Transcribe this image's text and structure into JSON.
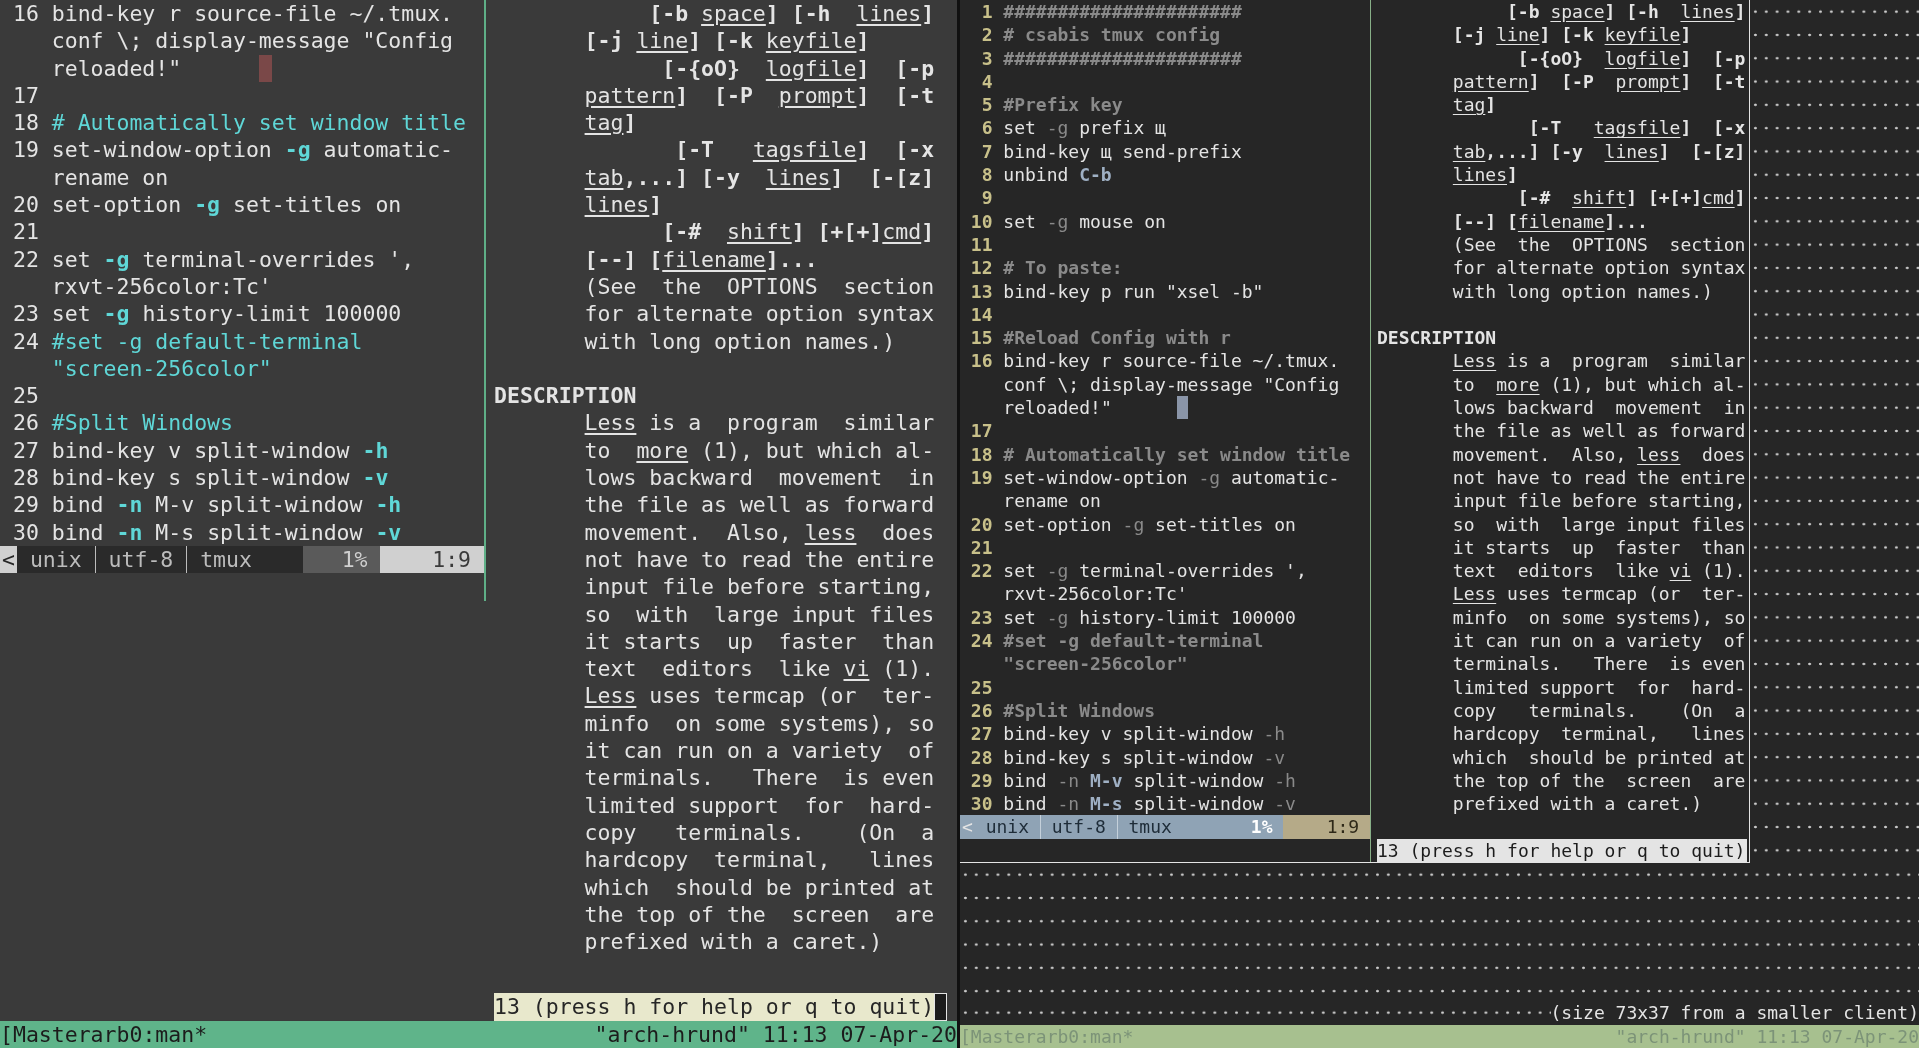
{
  "terminals": [
    {
      "kind": "gray",
      "editor": {
        "rows": [
          {
            "number": "16",
            "parts": [
              {
                "text": "bind-key r source-file ~/.tmux.",
                "kind": "plain"
              }
            ]
          },
          {
            "parts": [
              {
                "text": "conf \\; display-message \"Config",
                "kind": "plain"
              }
            ]
          },
          {
            "parts": [
              {
                "text": "reloaded!\"      ",
                "kind": "plain"
              },
              {
                "kind": "cursor"
              }
            ]
          },
          {
            "number": "17"
          },
          {
            "number": "18",
            "parts": [
              {
                "text": "# Automatically set window title",
                "kind": "comment"
              }
            ]
          },
          {
            "number": "19",
            "parts": [
              {
                "text": "set-window-option ",
                "kind": "plain"
              },
              {
                "text": "-g",
                "kind": "flag"
              },
              {
                "text": " automatic-",
                "kind": "plain"
              }
            ]
          },
          {
            "parts": [
              {
                "text": "rename on",
                "kind": "plain"
              }
            ]
          },
          {
            "number": "20",
            "parts": [
              {
                "text": "set-option ",
                "kind": "plain"
              },
              {
                "text": "-g",
                "kind": "flag"
              },
              {
                "text": " set-titles on",
                "kind": "plain"
              }
            ]
          },
          {
            "number": "21"
          },
          {
            "number": "22",
            "parts": [
              {
                "text": "set ",
                "kind": "plain"
              },
              {
                "text": "-g",
                "kind": "flag"
              },
              {
                "text": " terminal-overrides ',",
                "kind": "plain"
              }
            ]
          },
          {
            "parts": [
              {
                "text": "rxvt-256color:Tc'",
                "kind": "plain"
              }
            ]
          },
          {
            "number": "23",
            "parts": [
              {
                "text": "set ",
                "kind": "plain"
              },
              {
                "text": "-g",
                "kind": "flag"
              },
              {
                "text": " history-limit 100000",
                "kind": "plain"
              }
            ]
          },
          {
            "number": "24",
            "parts": [
              {
                "text": "#set -g default-terminal",
                "kind": "comment"
              }
            ]
          },
          {
            "parts": [
              {
                "text": "\"screen-256color\"",
                "kind": "comment"
              }
            ]
          },
          {
            "number": "25"
          },
          {
            "number": "26",
            "parts": [
              {
                "text": "#Split Windows",
                "kind": "comment"
              }
            ]
          },
          {
            "number": "27",
            "parts": [
              {
                "text": "bind-key v split-window ",
                "kind": "plain"
              },
              {
                "text": "-h",
                "kind": "flag"
              }
            ]
          },
          {
            "number": "28",
            "parts": [
              {
                "text": "bind-key s split-window ",
                "kind": "plain"
              },
              {
                "text": "-v",
                "kind": "flag"
              }
            ]
          },
          {
            "number": "29",
            "parts": [
              {
                "text": "bind ",
                "kind": "plain"
              },
              {
                "text": "-n ",
                "kind": "flag"
              },
              {
                "text": "M-v",
                "kind": "key"
              },
              {
                "text": " split-window ",
                "kind": "plain"
              },
              {
                "text": "-h",
                "kind": "flag"
              }
            ]
          },
          {
            "number": "30",
            "parts": [
              {
                "text": "bind ",
                "kind": "plain"
              },
              {
                "text": "-n ",
                "kind": "flag"
              },
              {
                "text": "M-s",
                "kind": "key"
              },
              {
                "text": " split-window ",
                "kind": "plain"
              },
              {
                "text": "-v",
                "kind": "flag"
              }
            ]
          }
        ],
        "status": {
          "arrow": "<",
          "items": [
            "unix",
            "utf-8",
            "tmux"
          ],
          "percent": "1%",
          "position": "1:9"
        }
      },
      "pager": {
        "rows": [
          {
            "kind": "text",
            "parts": [
              {
                "text": "     [-b ",
                "kind": "bold"
              },
              {
                "text": "space",
                "kind": "under"
              },
              {
                "text": "] [-h  ",
                "kind": "bold"
              },
              {
                "text": "lines",
                "kind": "under"
              },
              {
                "text": "]",
                "kind": "bold"
              }
            ]
          },
          {
            "kind": "text",
            "parts": [
              {
                "text": "[-j ",
                "kind": "bold"
              },
              {
                "text": "line",
                "kind": "under"
              },
              {
                "text": "] [-k ",
                "kind": "bold"
              },
              {
                "text": "keyfile",
                "kind": "under"
              },
              {
                "text": "]",
                "kind": "bold"
              }
            ]
          },
          {
            "kind": "text",
            "parts": [
              {
                "text": "      [-{oO}  ",
                "kind": "bold"
              },
              {
                "text": "logfile",
                "kind": "under"
              },
              {
                "text": "]  [-p",
                "kind": "bold"
              }
            ]
          },
          {
            "kind": "text",
            "parts": [
              {
                "text": "pattern",
                "kind": "under"
              },
              {
                "text": "]  [-P  ",
                "kind": "bold"
              },
              {
                "text": "prompt",
                "kind": "under"
              },
              {
                "text": "]  [-t",
                "kind": "bold"
              }
            ]
          },
          {
            "kind": "text",
            "parts": [
              {
                "text": "tag",
                "kind": "under"
              },
              {
                "text": "]",
                "kind": "bold"
              }
            ]
          },
          {
            "kind": "text",
            "parts": [
              {
                "text": "       [-T   ",
                "kind": "bold"
              },
              {
                "text": "tagsfile",
                "kind": "under"
              },
              {
                "text": "]  [-x",
                "kind": "bold"
              }
            ]
          },
          {
            "kind": "text",
            "parts": [
              {
                "text": "tab",
                "kind": "under"
              },
              {
                "text": ",...] [-y  ",
                "kind": "bold"
              },
              {
                "text": "lines",
                "kind": "under"
              },
              {
                "text": "]  [-[z]",
                "kind": "bold"
              }
            ]
          },
          {
            "kind": "text",
            "parts": [
              {
                "text": "lines",
                "kind": "under"
              },
              {
                "text": "]",
                "kind": "bold"
              }
            ]
          },
          {
            "kind": "text",
            "parts": [
              {
                "text": "      [-#  ",
                "kind": "bold"
              },
              {
                "text": "shift",
                "kind": "under"
              },
              {
                "text": "] [+[+]",
                "kind": "bold"
              },
              {
                "text": "cmd",
                "kind": "under"
              },
              {
                "text": "]",
                "kind": "bold"
              }
            ]
          },
          {
            "kind": "text",
            "parts": [
              {
                "text": "[--] [",
                "kind": "bold"
              },
              {
                "text": "filename",
                "kind": "under"
              },
              {
                "text": "]...",
                "kind": "bold"
              }
            ]
          },
          {
            "kind": "text",
            "parts": [
              {
                "text": "(See  the  OPTIONS  section",
                "kind": "plain"
              }
            ]
          },
          {
            "kind": "text",
            "parts": [
              {
                "text": "for alternate option syntax",
                "kind": "plain"
              }
            ]
          },
          {
            "kind": "text",
            "parts": [
              {
                "text": "with long option names.)",
                "kind": "plain"
              }
            ]
          },
          {
            "kind": "blank"
          },
          {
            "kind": "heading",
            "text": "DESCRIPTION"
          },
          {
            "kind": "text",
            "parts": [
              {
                "text": "Less",
                "kind": "under"
              },
              {
                "text": " is a  program  similar",
                "kind": "plain"
              }
            ]
          },
          {
            "kind": "text",
            "parts": [
              {
                "text": "to  ",
                "kind": "plain"
              },
              {
                "text": "more",
                "kind": "under"
              },
              {
                "text": " (1), but which al-",
                "kind": "plain"
              }
            ]
          },
          {
            "kind": "text",
            "parts": [
              {
                "text": "lows backward  movement  in",
                "kind": "plain"
              }
            ]
          },
          {
            "kind": "text",
            "parts": [
              {
                "text": "the file as well as forward",
                "kind": "plain"
              }
            ]
          },
          {
            "kind": "text",
            "parts": [
              {
                "text": "movement.  Also, ",
                "kind": "plain"
              },
              {
                "text": "less",
                "kind": "under"
              },
              {
                "text": "  does",
                "kind": "plain"
              }
            ]
          },
          {
            "kind": "text",
            "parts": [
              {
                "text": "not have to read the entire",
                "kind": "plain"
              }
            ]
          },
          {
            "kind": "text",
            "parts": [
              {
                "text": "input file before starting,",
                "kind": "plain"
              }
            ]
          },
          {
            "kind": "text",
            "parts": [
              {
                "text": "so  with  large input files",
                "kind": "plain"
              }
            ]
          },
          {
            "kind": "text",
            "parts": [
              {
                "text": "it starts  up  faster  than",
                "kind": "plain"
              }
            ]
          },
          {
            "kind": "text",
            "parts": [
              {
                "text": "text  editors  like ",
                "kind": "plain"
              },
              {
                "text": "vi",
                "kind": "under"
              },
              {
                "text": " (1).",
                "kind": "plain"
              }
            ]
          },
          {
            "kind": "text",
            "parts": [
              {
                "text": "Less",
                "kind": "under"
              },
              {
                "text": " uses termcap (or  ter-",
                "kind": "plain"
              }
            ]
          },
          {
            "kind": "text",
            "parts": [
              {
                "text": "minfo  on some systems), so",
                "kind": "plain"
              }
            ]
          },
          {
            "kind": "text",
            "parts": [
              {
                "text": "it can run on a variety  of",
                "kind": "plain"
              }
            ]
          },
          {
            "kind": "text",
            "parts": [
              {
                "text": "terminals.   There  is even",
                "kind": "plain"
              }
            ]
          },
          {
            "kind": "text",
            "parts": [
              {
                "text": "limited support  for  hard-",
                "kind": "plain"
              }
            ]
          },
          {
            "kind": "text",
            "parts": [
              {
                "text": "copy   terminals.    (On  a",
                "kind": "plain"
              }
            ]
          },
          {
            "kind": "text",
            "parts": [
              {
                "text": "hardcopy  terminal,   lines",
                "kind": "plain"
              }
            ]
          },
          {
            "kind": "text",
            "parts": [
              {
                "text": "which  should be printed at",
                "kind": "plain"
              }
            ]
          },
          {
            "kind": "text",
            "parts": [
              {
                "text": "the top of the  screen  are",
                "kind": "plain"
              }
            ]
          },
          {
            "kind": "text",
            "parts": [
              {
                "text": "prefixed with a caret.)",
                "kind": "plain"
              }
            ]
          }
        ],
        "prompt": "13 (press h for help or q to quit)"
      },
      "status_bar": {
        "session": "[Masterarb0:man*",
        "host": "\"arch-hrund\" 11:13 07-Apr-20"
      }
    },
    {
      "kind": "dark",
      "editor": {
        "rows": [
          {
            "number": "1",
            "parts": [
              {
                "text": "######################",
                "kind": "comment"
              }
            ]
          },
          {
            "number": "2",
            "parts": [
              {
                "text": "# csabis tmux config",
                "kind": "comment"
              }
            ]
          },
          {
            "number": "3",
            "parts": [
              {
                "text": "######################",
                "kind": "comment"
              }
            ]
          },
          {
            "number": "4"
          },
          {
            "number": "5",
            "parts": [
              {
                "text": "#Prefix key",
                "kind": "comment"
              }
            ]
          },
          {
            "number": "6",
            "parts": [
              {
                "text": "set ",
                "kind": "plain"
              },
              {
                "text": "-g",
                "kind": "flag"
              },
              {
                "text": " prefix щ",
                "kind": "plain"
              }
            ]
          },
          {
            "number": "7",
            "parts": [
              {
                "text": "bind-key щ send-prefix",
                "kind": "plain"
              }
            ]
          },
          {
            "number": "8",
            "parts": [
              {
                "text": "unbind ",
                "kind": "plain"
              },
              {
                "text": "C-b",
                "kind": "key"
              }
            ]
          },
          {
            "number": "9"
          },
          {
            "number": "10",
            "parts": [
              {
                "text": "set ",
                "kind": "plain"
              },
              {
                "text": "-g",
                "kind": "flag"
              },
              {
                "text": " mouse on",
                "kind": "plain"
              }
            ]
          },
          {
            "number": "11"
          },
          {
            "number": "12",
            "parts": [
              {
                "text": "# To paste:",
                "kind": "comment"
              }
            ]
          },
          {
            "number": "13",
            "parts": [
              {
                "text": "bind-key p run \"xsel -b\"",
                "kind": "plain"
              }
            ]
          },
          {
            "number": "14"
          },
          {
            "number": "15",
            "parts": [
              {
                "text": "#Reload Config with r",
                "kind": "comment"
              }
            ]
          },
          {
            "number": "16",
            "parts": [
              {
                "text": "bind-key r source-file ~/.tmux.",
                "kind": "plain"
              }
            ]
          },
          {
            "parts": [
              {
                "text": "conf \\; display-message \"Config",
                "kind": "plain"
              }
            ]
          },
          {
            "parts": [
              {
                "text": "reloaded!\"      ",
                "kind": "plain"
              },
              {
                "kind": "cursor"
              }
            ]
          },
          {
            "number": "17"
          },
          {
            "number": "18",
            "parts": [
              {
                "text": "# Automatically set window title",
                "kind": "comment"
              }
            ]
          },
          {
            "number": "19",
            "parts": [
              {
                "text": "set-window-option ",
                "kind": "plain"
              },
              {
                "text": "-g",
                "kind": "flag"
              },
              {
                "text": " automatic-",
                "kind": "plain"
              }
            ]
          },
          {
            "parts": [
              {
                "text": "rename on",
                "kind": "plain"
              }
            ]
          },
          {
            "number": "20",
            "parts": [
              {
                "text": "set-option ",
                "kind": "plain"
              },
              {
                "text": "-g",
                "kind": "flag"
              },
              {
                "text": " set-titles on",
                "kind": "plain"
              }
            ]
          },
          {
            "number": "21"
          },
          {
            "number": "22",
            "parts": [
              {
                "text": "set ",
                "kind": "plain"
              },
              {
                "text": "-g",
                "kind": "flag"
              },
              {
                "text": " terminal-overrides ',",
                "kind": "plain"
              }
            ]
          },
          {
            "parts": [
              {
                "text": "rxvt-256color:Tc'",
                "kind": "plain"
              }
            ]
          },
          {
            "number": "23",
            "parts": [
              {
                "text": "set ",
                "kind": "plain"
              },
              {
                "text": "-g",
                "kind": "flag"
              },
              {
                "text": " history-limit 100000",
                "kind": "plain"
              }
            ]
          },
          {
            "number": "24",
            "parts": [
              {
                "text": "#set -g default-terminal",
                "kind": "comment"
              }
            ]
          },
          {
            "parts": [
              {
                "text": "\"screen-256color\"",
                "kind": "comment"
              }
            ]
          },
          {
            "number": "25"
          },
          {
            "number": "26",
            "parts": [
              {
                "text": "#Split Windows",
                "kind": "comment"
              }
            ]
          },
          {
            "number": "27",
            "parts": [
              {
                "text": "bind-key v split-window ",
                "kind": "plain"
              },
              {
                "text": "-h",
                "kind": "flag"
              }
            ]
          },
          {
            "number": "28",
            "parts": [
              {
                "text": "bind-key s split-window ",
                "kind": "plain"
              },
              {
                "text": "-v",
                "kind": "flag"
              }
            ]
          },
          {
            "number": "29",
            "parts": [
              {
                "text": "bind ",
                "kind": "plain"
              },
              {
                "text": "-n ",
                "kind": "flag"
              },
              {
                "text": "M-v",
                "kind": "key"
              },
              {
                "text": " split-window ",
                "kind": "plain"
              },
              {
                "text": "-h",
                "kind": "flag"
              }
            ]
          },
          {
            "number": "30",
            "parts": [
              {
                "text": "bind ",
                "kind": "plain"
              },
              {
                "text": "-n ",
                "kind": "flag"
              },
              {
                "text": "M-s",
                "kind": "key"
              },
              {
                "text": " split-window ",
                "kind": "plain"
              },
              {
                "text": "-v",
                "kind": "flag"
              }
            ]
          }
        ],
        "status": {
          "arrow": "<",
          "items": [
            "unix",
            "utf-8",
            "tmux"
          ],
          "percent": "1%",
          "position": "1:9"
        }
      },
      "pager": {
        "rows": [
          {
            "kind": "text",
            "parts": [
              {
                "text": "     [-b ",
                "kind": "bold"
              },
              {
                "text": "space",
                "kind": "under"
              },
              {
                "text": "] [-h  ",
                "kind": "bold"
              },
              {
                "text": "lines",
                "kind": "under"
              },
              {
                "text": "]",
                "kind": "bold"
              }
            ]
          },
          {
            "kind": "text",
            "parts": [
              {
                "text": "[-j ",
                "kind": "bold"
              },
              {
                "text": "line",
                "kind": "under"
              },
              {
                "text": "] [-k ",
                "kind": "bold"
              },
              {
                "text": "keyfile",
                "kind": "under"
              },
              {
                "text": "]",
                "kind": "bold"
              }
            ]
          },
          {
            "kind": "text",
            "parts": [
              {
                "text": "      [-{oO}  ",
                "kind": "bold"
              },
              {
                "text": "logfile",
                "kind": "under"
              },
              {
                "text": "]  [-p",
                "kind": "bold"
              }
            ]
          },
          {
            "kind": "text",
            "parts": [
              {
                "text": "pattern",
                "kind": "under"
              },
              {
                "text": "]  [-P  ",
                "kind": "bold"
              },
              {
                "text": "prompt",
                "kind": "under"
              },
              {
                "text": "]  [-t",
                "kind": "bold"
              }
            ]
          },
          {
            "kind": "text",
            "parts": [
              {
                "text": "tag",
                "kind": "under"
              },
              {
                "text": "]",
                "kind": "bold"
              }
            ]
          },
          {
            "kind": "text",
            "parts": [
              {
                "text": "       [-T   ",
                "kind": "bold"
              },
              {
                "text": "tagsfile",
                "kind": "under"
              },
              {
                "text": "]  [-x",
                "kind": "bold"
              }
            ]
          },
          {
            "kind": "text",
            "parts": [
              {
                "text": "tab",
                "kind": "under"
              },
              {
                "text": ",...] [-y  ",
                "kind": "bold"
              },
              {
                "text": "lines",
                "kind": "under"
              },
              {
                "text": "]  [-[z]",
                "kind": "bold"
              }
            ]
          },
          {
            "kind": "text",
            "parts": [
              {
                "text": "lines",
                "kind": "under"
              },
              {
                "text": "]",
                "kind": "bold"
              }
            ]
          },
          {
            "kind": "text",
            "parts": [
              {
                "text": "      [-#  ",
                "kind": "bold"
              },
              {
                "text": "shift",
                "kind": "under"
              },
              {
                "text": "] [+[+]",
                "kind": "bold"
              },
              {
                "text": "cmd",
                "kind": "under"
              },
              {
                "text": "]",
                "kind": "bold"
              }
            ]
          },
          {
            "kind": "text",
            "parts": [
              {
                "text": "[--] [",
                "kind": "bold"
              },
              {
                "text": "filename",
                "kind": "under"
              },
              {
                "text": "]...",
                "kind": "bold"
              }
            ]
          },
          {
            "kind": "text",
            "parts": [
              {
                "text": "(See  the  OPTIONS  section",
                "kind": "plain"
              }
            ]
          },
          {
            "kind": "text",
            "parts": [
              {
                "text": "for alternate option syntax",
                "kind": "plain"
              }
            ]
          },
          {
            "kind": "text",
            "parts": [
              {
                "text": "with long option names.)",
                "kind": "plain"
              }
            ]
          },
          {
            "kind": "blank"
          },
          {
            "kind": "heading",
            "text": "DESCRIPTION"
          },
          {
            "kind": "text",
            "parts": [
              {
                "text": "Less",
                "kind": "under"
              },
              {
                "text": " is a  program  similar",
                "kind": "plain"
              }
            ]
          },
          {
            "kind": "text",
            "parts": [
              {
                "text": "to  ",
                "kind": "plain"
              },
              {
                "text": "more",
                "kind": "under"
              },
              {
                "text": " (1), but which al-",
                "kind": "plain"
              }
            ]
          },
          {
            "kind": "text",
            "parts": [
              {
                "text": "lows backward  movement  in",
                "kind": "plain"
              }
            ]
          },
          {
            "kind": "text",
            "parts": [
              {
                "text": "the file as well as forward",
                "kind": "plain"
              }
            ]
          },
          {
            "kind": "text",
            "parts": [
              {
                "text": "movement.  Also, ",
                "kind": "plain"
              },
              {
                "text": "less",
                "kind": "under"
              },
              {
                "text": "  does",
                "kind": "plain"
              }
            ]
          },
          {
            "kind": "text",
            "parts": [
              {
                "text": "not have to read the entire",
                "kind": "plain"
              }
            ]
          },
          {
            "kind": "text",
            "parts": [
              {
                "text": "input file before starting,",
                "kind": "plain"
              }
            ]
          },
          {
            "kind": "text",
            "parts": [
              {
                "text": "so  with  large input files",
                "kind": "plain"
              }
            ]
          },
          {
            "kind": "text",
            "parts": [
              {
                "text": "it starts  up  faster  than",
                "kind": "plain"
              }
            ]
          },
          {
            "kind": "text",
            "parts": [
              {
                "text": "text  editors  like ",
                "kind": "plain"
              },
              {
                "text": "vi",
                "kind": "under"
              },
              {
                "text": " (1).",
                "kind": "plain"
              }
            ]
          },
          {
            "kind": "text",
            "parts": [
              {
                "text": "Less",
                "kind": "under"
              },
              {
                "text": " uses termcap (or  ter-",
                "kind": "plain"
              }
            ]
          },
          {
            "kind": "text",
            "parts": [
              {
                "text": "minfo  on some systems), so",
                "kind": "plain"
              }
            ]
          },
          {
            "kind": "text",
            "parts": [
              {
                "text": "it can run on a variety  of",
                "kind": "plain"
              }
            ]
          },
          {
            "kind": "text",
            "parts": [
              {
                "text": "terminals.   There  is even",
                "kind": "plain"
              }
            ]
          },
          {
            "kind": "text",
            "parts": [
              {
                "text": "limited support  for  hard-",
                "kind": "plain"
              }
            ]
          },
          {
            "kind": "text",
            "parts": [
              {
                "text": "copy   terminals.    (On  a",
                "kind": "plain"
              }
            ]
          },
          {
            "kind": "text",
            "parts": [
              {
                "text": "hardcopy  terminal,   lines",
                "kind": "plain"
              }
            ]
          },
          {
            "kind": "text",
            "parts": [
              {
                "text": "which  should be printed at",
                "kind": "plain"
              }
            ]
          },
          {
            "kind": "text",
            "parts": [
              {
                "text": "the top of the  screen  are",
                "kind": "plain"
              }
            ]
          },
          {
            "kind": "text",
            "parts": [
              {
                "text": "prefixed with a caret.)",
                "kind": "plain"
              }
            ]
          }
        ],
        "prompt": "13 (press h for help or q to quit)"
      },
      "size_notice": "(size 73x37 from a smaller client)",
      "status_bar": {
        "session": "[Masterarb0:man*",
        "host": "\"arch-hrund\" 11:13 07-Apr-20"
      }
    }
  ]
}
